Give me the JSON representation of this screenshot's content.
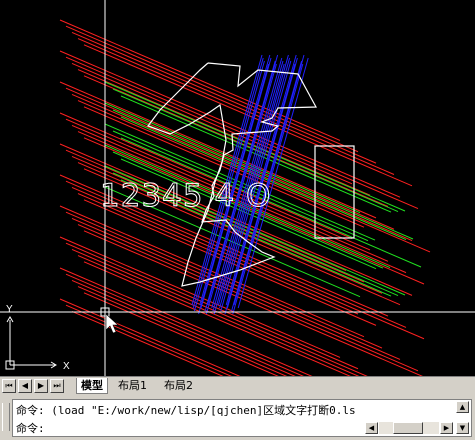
{
  "ucs": {
    "x_label": "X",
    "y_label": "Y"
  },
  "drawing": {
    "text_string": "12345 4 O",
    "colors": {
      "red": "#ff2020",
      "green": "#20e020",
      "blue": "#2020ff",
      "white": "#ffffff",
      "background": "#000000",
      "crosshair": "#ffffff"
    }
  },
  "tabs": {
    "nav_first": "⏮",
    "nav_prev": "◀",
    "nav_next": "▶",
    "nav_last": "⏭",
    "items": [
      {
        "label": "模型",
        "active": true
      },
      {
        "label": "布局1",
        "active": false
      },
      {
        "label": "布局2",
        "active": false
      }
    ]
  },
  "command": {
    "line1": "命令: (load \"E:/work/new/lisp/[qjchen]区域文字打断0.ls",
    "line2": "命令:"
  },
  "scroll": {
    "up": "▲",
    "down": "▼",
    "left": "◀",
    "right": "▶"
  }
}
